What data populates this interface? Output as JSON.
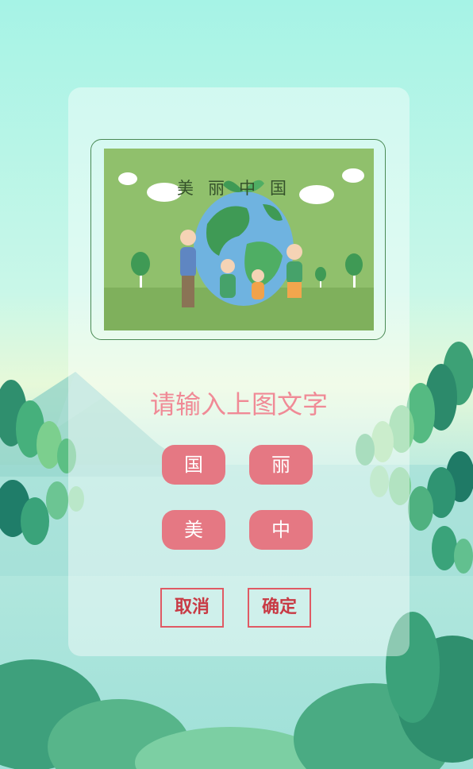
{
  "captcha": {
    "title": "美丽中国",
    "image_alt": "earth-family-illustration"
  },
  "prompt": {
    "text": "请输入上图文字"
  },
  "char_buttons": [
    {
      "label": "国"
    },
    {
      "label": "丽"
    },
    {
      "label": "美"
    },
    {
      "label": "中"
    }
  ],
  "actions": {
    "cancel": "取消",
    "confirm": "确定"
  },
  "colors": {
    "char_button_bg": "#e57883",
    "prompt_text": "#f08a96",
    "action_border": "#e05a64",
    "captcha_bg": "#8fbf6b"
  }
}
